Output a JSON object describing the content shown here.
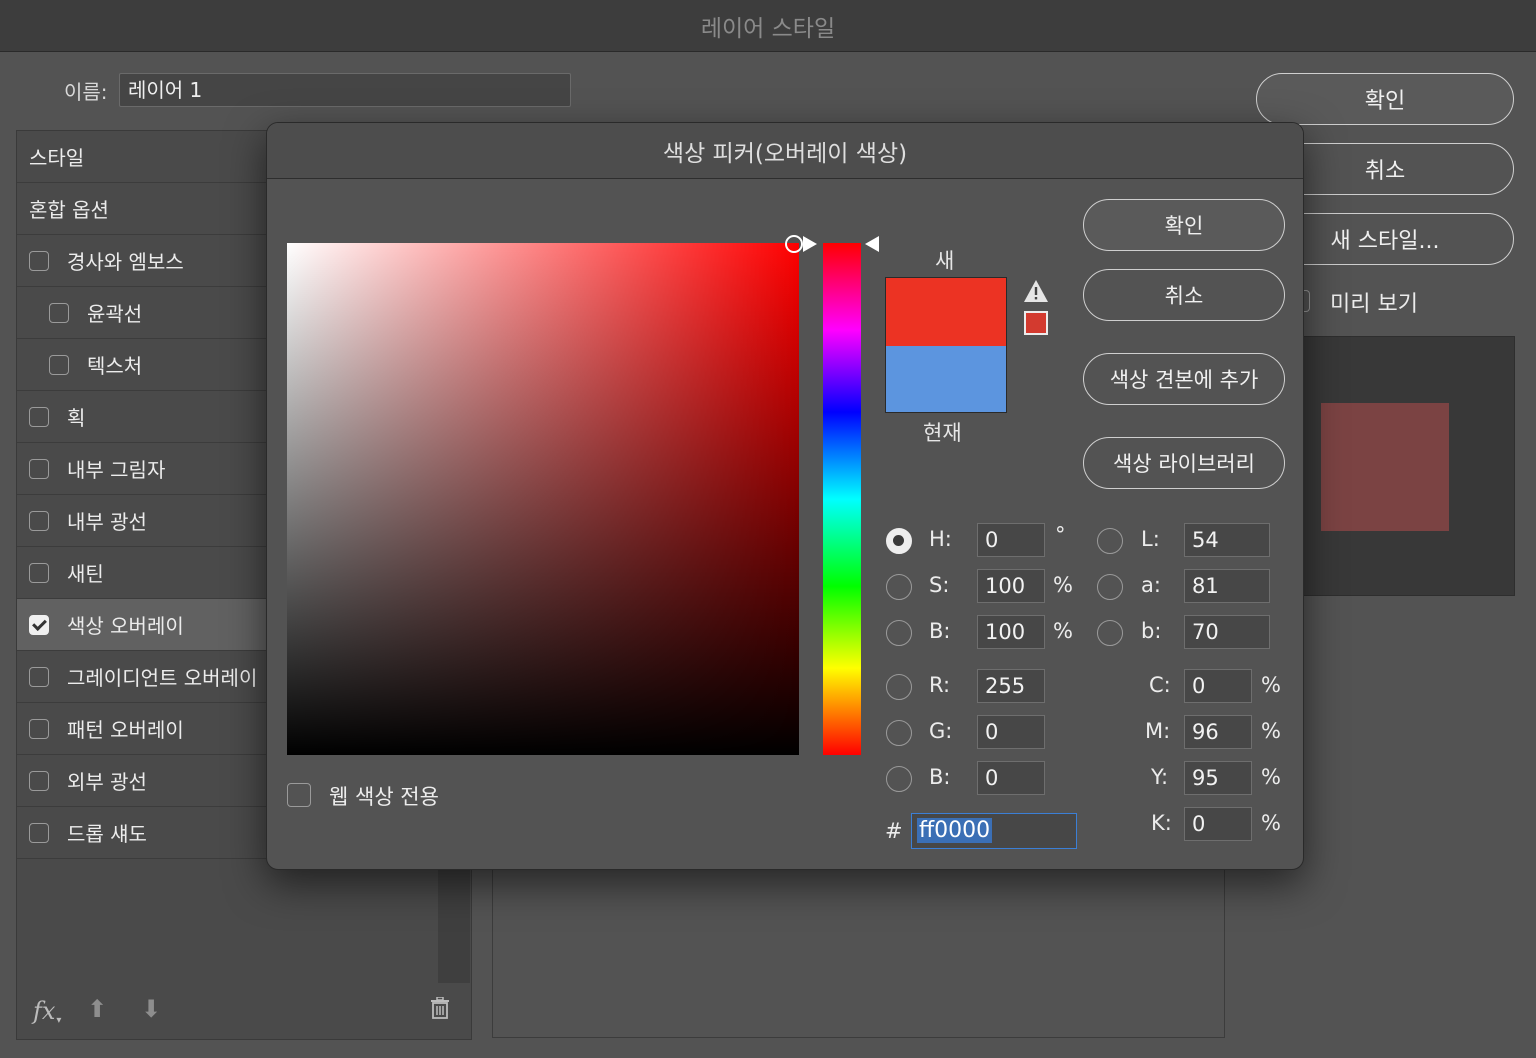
{
  "window": {
    "title": "레이어 스타일"
  },
  "name_field": {
    "label": "이름:",
    "value": "레이어 1"
  },
  "styles": {
    "header": "스타일",
    "blend_options": "혼합 옵션",
    "items": [
      {
        "label": "경사와 엠보스",
        "checked": false,
        "indent": 0
      },
      {
        "label": "윤곽선",
        "checked": false,
        "indent": 1
      },
      {
        "label": "텍스처",
        "checked": false,
        "indent": 1
      },
      {
        "label": "획",
        "checked": false,
        "indent": 0
      },
      {
        "label": "내부 그림자",
        "checked": false,
        "indent": 0
      },
      {
        "label": "내부 광선",
        "checked": false,
        "indent": 0
      },
      {
        "label": "새틴",
        "checked": false,
        "indent": 0
      },
      {
        "label": "색상 오버레이",
        "checked": true,
        "indent": 0
      },
      {
        "label": "그레이디언트 오버레이",
        "checked": false,
        "indent": 0
      },
      {
        "label": "패턴 오버레이",
        "checked": false,
        "indent": 0
      },
      {
        "label": "외부 광선",
        "checked": false,
        "indent": 0
      },
      {
        "label": "드롭 섀도",
        "checked": false,
        "indent": 0
      }
    ],
    "footer": {
      "fx_label": "fx"
    }
  },
  "outer_buttons": {
    "ok": "확인",
    "cancel": "취소",
    "new_style": "새 스타일...",
    "preview": "미리 보기"
  },
  "preview_color": "#7b4343",
  "picker": {
    "title": "색상 피커(오버레이 색상)",
    "new_label": "새",
    "current_label": "현재",
    "new_color": "#ec3323",
    "current_color": "#5c95df",
    "buttons": {
      "ok": "확인",
      "cancel": "취소",
      "add_swatch": "색상 견본에 추가",
      "libraries": "색상 라이브러리"
    },
    "web_only": "웹 색상 전용",
    "hsb": [
      {
        "label": "H:",
        "value": "0",
        "unit": "°"
      },
      {
        "label": "S:",
        "value": "100",
        "unit": "%"
      },
      {
        "label": "B:",
        "value": "100",
        "unit": "%"
      }
    ],
    "rgb": [
      {
        "label": "R:",
        "value": "255"
      },
      {
        "label": "G:",
        "value": "0"
      },
      {
        "label": "B:",
        "value": "0"
      }
    ],
    "lab": [
      {
        "label": "L:",
        "value": "54"
      },
      {
        "label": "a:",
        "value": "81"
      },
      {
        "label": "b:",
        "value": "70"
      }
    ],
    "cmyk": [
      {
        "label": "C:",
        "value": "0",
        "unit": "%"
      },
      {
        "label": "M:",
        "value": "96",
        "unit": "%"
      },
      {
        "label": "Y:",
        "value": "95",
        "unit": "%"
      },
      {
        "label": "K:",
        "value": "0",
        "unit": "%"
      }
    ],
    "hex_label": "#",
    "hex_value": "ff0000"
  }
}
